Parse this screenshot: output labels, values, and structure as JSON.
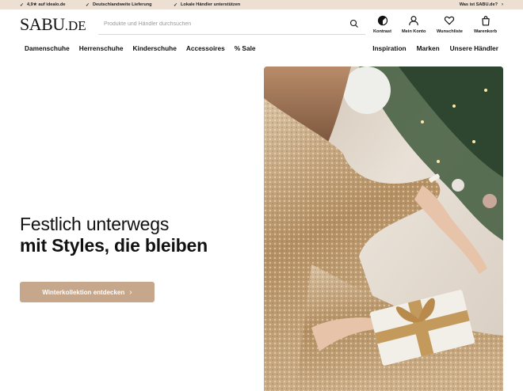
{
  "usp_bar": {
    "items": [
      "4,9★ auf idealo.de",
      "Deutschlandweite Lieferung",
      "Lokale Händler unterstützen"
    ],
    "right_link": "Was ist SABU.de?"
  },
  "header": {
    "logo_main": "SABU",
    "logo_suffix": ".DE",
    "search_placeholder": "Produkte und Händler durchsuchen",
    "actions": {
      "contrast": "Kontrast",
      "account": "Mein Konto",
      "wishlist": "Wunschliste",
      "cart": "Warenkorb"
    }
  },
  "nav": {
    "left": [
      "Damenschuhe",
      "Herrenschuhe",
      "Kinderschuhe",
      "Accessoires",
      "% Sale"
    ],
    "right": [
      "Inspiration",
      "Marken",
      "Unsere Händler"
    ]
  },
  "hero": {
    "title_line1": "Festlich unterwegs",
    "title_line2": "mit Styles, die bleiben",
    "cta_label": "Winterkollektion entdecken"
  },
  "colors": {
    "usp_bg": "#ede0d2",
    "cta_bg": "#c7a78b",
    "text": "#111111"
  },
  "icons": [
    "check-icon",
    "chevron-right-icon",
    "search-icon",
    "contrast-icon",
    "user-icon",
    "heart-icon",
    "bag-icon"
  ]
}
